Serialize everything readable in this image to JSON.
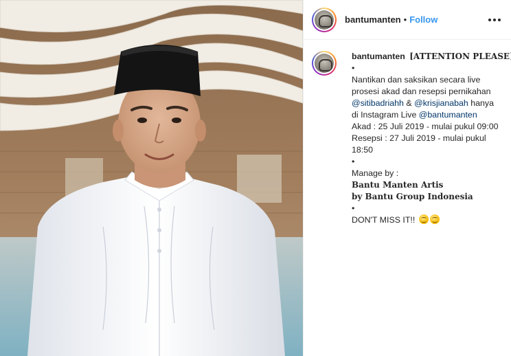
{
  "post": {
    "username": "bantumanten",
    "separator": "•",
    "follow_label": "Follow",
    "more_icon": "more-options-icon"
  },
  "caption": {
    "username": "bantumanten",
    "headline": "[ATTENTION PLEASE]",
    "bullet": "•",
    "line1": "Nantikan dan saksikan secara live",
    "line2": "prosesi akad dan resepsi pernikahan",
    "mention1": "@sitibadriahh",
    "amp": " & ",
    "mention2": "@krisjianabah",
    "hanya": " hanya",
    "line4_prefix": "di Instagram Live ",
    "mention3": "@bantumanten",
    "akad": "Akad : 25 Juli 2019 - mulai pukul 09:00",
    "resepsi1": "Resepsi : 27 Juli 2019 - mulai pukul",
    "resepsi2": "18:50",
    "manage": "Manage by :",
    "org1": "Bantu Manten Artis",
    "org2": "by Bantu Group Indonesia",
    "dont_miss": "DON'T MISS IT!!",
    "emoji": "smiling-face-emoji"
  },
  "colors": {
    "link": "#3897f0",
    "mention": "#003569",
    "text": "#262626"
  }
}
